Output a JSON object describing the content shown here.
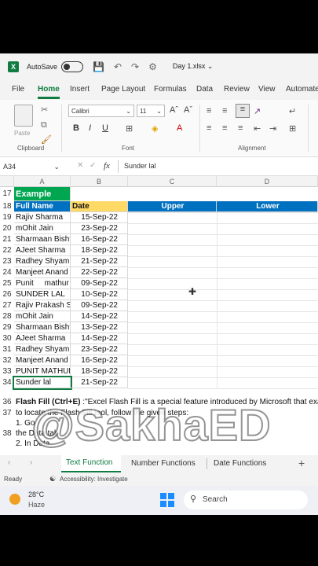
{
  "titlebar": {
    "autosave_label": "AutoSave",
    "filename": "Day 1.xlsx ⌄"
  },
  "menu": [
    "File",
    "Home",
    "Insert",
    "Page Layout",
    "Formulas",
    "Data",
    "Review",
    "View",
    "Automate"
  ],
  "ribbon": {
    "paste_label": "Paste",
    "font_name": "Calibri",
    "font_size": "11",
    "groups": {
      "clipboard": "Clipboard",
      "font": "Font",
      "alignment": "Alignment"
    }
  },
  "formula_bar": {
    "name_box": "A34",
    "fx": "fx",
    "content": "Sunder lal"
  },
  "columns": [
    "A",
    "B",
    "C",
    "D"
  ],
  "header_row": {
    "num": "18",
    "a": "Full Name",
    "b": "Date",
    "c": "Upper",
    "d": "Lower"
  },
  "example_row": {
    "num": "17",
    "label": "Example"
  },
  "rows": [
    {
      "num": "19",
      "name": "Rajiv Sharma",
      "date": "15-Sep-22"
    },
    {
      "num": "20",
      "name": "mOhit Jain",
      "date": "23-Sep-22"
    },
    {
      "num": "21",
      "name": "Sharmaan Bisht",
      "date": "16-Sep-22"
    },
    {
      "num": "22",
      "name": "AJeet Sharma",
      "date": "18-Sep-22"
    },
    {
      "num": "23",
      "name": "Radhey Shyam",
      "date": "21-Sep-22"
    },
    {
      "num": "24",
      "name": "Manjeet Anand",
      "date": "22-Sep-22"
    },
    {
      "num": "25",
      "name": "Punit     mathur",
      "date": "09-Sep-22"
    },
    {
      "num": "26",
      "name": "SUNDER LAL",
      "date": "10-Sep-22"
    },
    {
      "num": "27",
      "name": "Rajiv Prakash Sh",
      "date": "09-Sep-22"
    },
    {
      "num": "28",
      "name": "mOhit Jain",
      "date": "14-Sep-22"
    },
    {
      "num": "29",
      "name": "Sharmaan Bisht",
      "date": "13-Sep-22"
    },
    {
      "num": "30",
      "name": "AJeet Sharma",
      "date": "14-Sep-22"
    },
    {
      "num": "31",
      "name": "Radhey Shyam",
      "date": "23-Sep-22"
    },
    {
      "num": "32",
      "name": "Manjeet Anand",
      "date": "16-Sep-22"
    },
    {
      "num": "33",
      "name": "PUNIT MATHUR",
      "date": "18-Sep-22"
    },
    {
      "num": "34",
      "name": "Sunder lal",
      "date": "21-Sep-22"
    }
  ],
  "notes": [
    {
      "num": "36",
      "text_bold": "Flash Fill (Ctrl+E)",
      "text": " :\"Excel Flash Fill is a special feature introduced by Microsoft that exami"
    },
    {
      "num": "37",
      "text_bold": "",
      "text": "  to locate the Flash Fill tool, follow the given steps:"
    },
    {
      "num": "",
      "text_bold": "",
      "text": "1.      Go"
    },
    {
      "num": "38",
      "text_bold": "",
      "text": "the Data tab."
    },
    {
      "num": "",
      "text_bold": "",
      "text": "2.   In      Data"
    }
  ],
  "sheets": [
    "Text Function",
    "Number Functions",
    "Date Functions"
  ],
  "status": {
    "ready": "Ready",
    "accessibility": "Accessibility: Investigate"
  },
  "taskbar": {
    "temp": "28°C",
    "weather": "Haze",
    "search": "Search"
  },
  "watermark": "@SakhaED",
  "colors": {
    "excel_green": "#107c41",
    "header_blue": "#0070c0",
    "example_green": "#00a650",
    "date_yellow": "#ffd966"
  }
}
